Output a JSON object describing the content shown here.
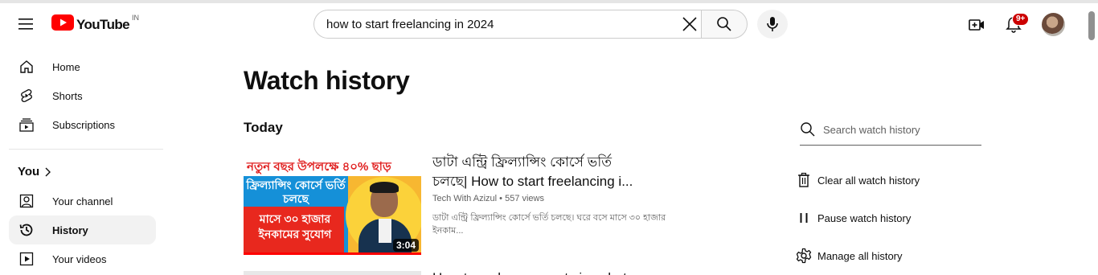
{
  "header": {
    "logo_text": "YouTube",
    "country_code": "IN",
    "search_query": "how to start freelancing in 2024",
    "notification_count": "9+",
    "brand_color": "#ff0000"
  },
  "sidebar": {
    "top_items": [
      {
        "label": "Home",
        "icon": "home-icon"
      },
      {
        "label": "Shorts",
        "icon": "shorts-icon"
      },
      {
        "label": "Subscriptions",
        "icon": "subscriptions-icon"
      }
    ],
    "you_heading": "You",
    "you_items": [
      {
        "label": "Your channel",
        "icon": "your-channel-icon"
      },
      {
        "label": "History",
        "icon": "history-icon",
        "active": true
      },
      {
        "label": "Your videos",
        "icon": "your-videos-icon"
      }
    ]
  },
  "main": {
    "page_title": "Watch history",
    "section_title": "Today",
    "videos": [
      {
        "thumbnail_banner": "নতুন বছর উপলক্ষে ৪০% ছাড়",
        "thumbnail_text_1": "ফ্রিল্যান্সিং কোর্সে ভর্তি চলছে",
        "thumbnail_text_2": "মাসে ৩০ হাজার ইনকামের সুযোগ",
        "duration": "3:04",
        "watched_fraction": 1.0,
        "title": "ডাটা এন্ট্রি ফ্রিল্যান্সিং কোর্সে ভর্তি চলছে| How to start freelancing i...",
        "channel": "Tech With Azizul",
        "separator": "•",
        "views": "557 views",
        "description": "ডাটা এন্ট্রি ফ্রিল্যান্সিং কোর্সে ভর্তি চলছে। ঘরে বসে মাসে ৩০ হাজার ইনকাম..."
      },
      {
        "title": "How to make passport size photo"
      }
    ]
  },
  "right_panel": {
    "search_placeholder": "Search watch history",
    "actions": [
      {
        "label": "Clear all watch history",
        "icon": "trash-icon"
      },
      {
        "label": "Pause watch history",
        "icon": "pause-icon"
      },
      {
        "label": "Manage all history",
        "icon": "gear-icon"
      }
    ]
  }
}
